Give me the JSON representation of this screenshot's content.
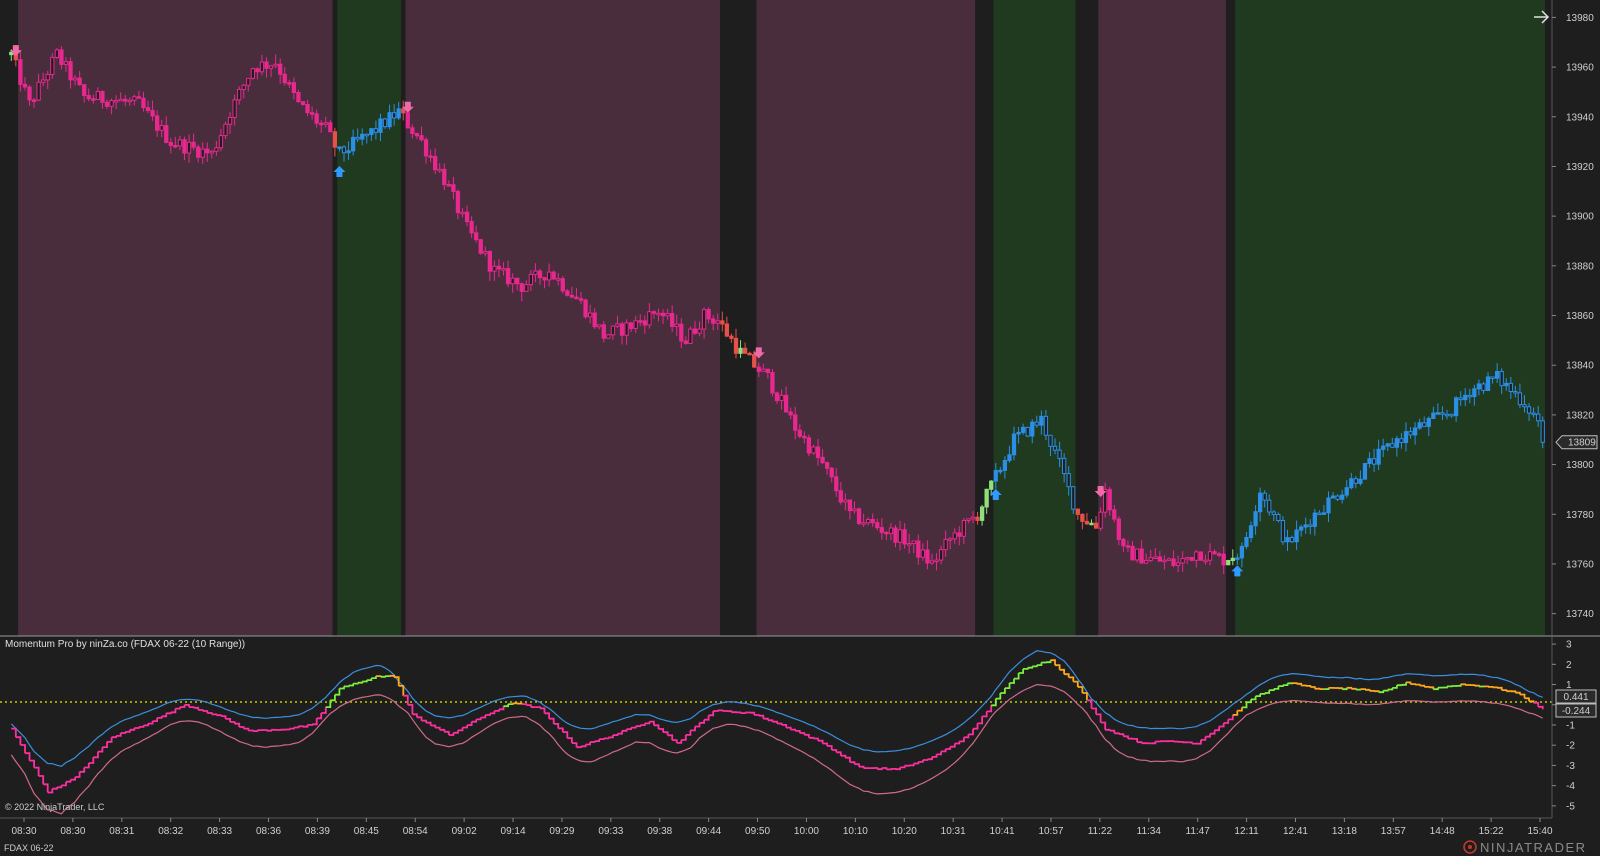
{
  "colors": {
    "background": "#1e1e1e",
    "bear_zone": "#4a2d3c",
    "bull_zone": "#1f3a1f",
    "bear_candle": "#e8288f",
    "bull_candle": "#2b8fe6",
    "transition_candle": "#8fe07a",
    "transition_alt": "#e8504a",
    "arrow_down": "#f06aa9",
    "arrow_up": "#2f9bff",
    "osc_fast_pink": "#ff2fa0",
    "osc_fast_green": "#7cf03c",
    "osc_fast_orange": "#ffa81a",
    "osc_upper_band": "#3a8fe0",
    "osc_lower_band": "#d06a8c",
    "zero_line": "#c8c800"
  },
  "header_icon": "arrow-right-icon",
  "price_panel": {
    "current_price_label": "13809"
  },
  "indicator_panel": {
    "title": "Momentum Pro by ninZa.co (FDAX 06-22 (10 Range))",
    "copyright": "© 2022 NinjaTrader, LLC",
    "badge_upper": "0.441",
    "badge_lower": "-0.244"
  },
  "footer": {
    "instrument": "FDAX 06-22",
    "brand": "NINJATRADER"
  },
  "chart_data": [
    {
      "type": "candlestick",
      "title": "",
      "x_tick_labels": [
        "08:30",
        "08:30",
        "08:31",
        "08:32",
        "08:33",
        "08:36",
        "08:39",
        "08:45",
        "08:54",
        "09:02",
        "09:14",
        "09:29",
        "09:33",
        "09:38",
        "09:44",
        "09:50",
        "10:00",
        "10:10",
        "10:20",
        "10:31",
        "10:41",
        "10:57",
        "11:22",
        "11:34",
        "11:47",
        "12:11",
        "12:41",
        "13:18",
        "13:57",
        "14:48",
        "15:22",
        "15:40"
      ],
      "y_tick_labels": [
        "13980",
        "13960",
        "13940",
        "13920",
        "13900",
        "13880",
        "13860",
        "13840",
        "13820",
        "13800",
        "13780",
        "13760",
        "13740"
      ],
      "ylim": [
        13731,
        13987
      ],
      "last_price": 13809,
      "price_path_keypoints": [
        [
          0,
          13965
        ],
        [
          4,
          13945
        ],
        [
          10,
          13965
        ],
        [
          16,
          13948
        ],
        [
          22,
          13947
        ],
        [
          28,
          13945
        ],
        [
          35,
          13930
        ],
        [
          44,
          13925
        ],
        [
          48,
          13942
        ],
        [
          53,
          13960
        ],
        [
          58,
          13962
        ],
        [
          63,
          13945
        ],
        [
          69,
          13935
        ],
        [
          72,
          13925
        ],
        [
          76,
          13930
        ],
        [
          80,
          13935
        ],
        [
          85,
          13942
        ],
        [
          90,
          13930
        ],
        [
          95,
          13915
        ],
        [
          100,
          13895
        ],
        [
          106,
          13878
        ],
        [
          112,
          13872
        ],
        [
          118,
          13878
        ],
        [
          125,
          13865
        ],
        [
          130,
          13852
        ],
        [
          136,
          13856
        ],
        [
          142,
          13862
        ],
        [
          148,
          13850
        ],
        [
          152,
          13860
        ],
        [
          155,
          13858
        ],
        [
          160,
          13845
        ],
        [
          166,
          13835
        ],
        [
          172,
          13815
        ],
        [
          178,
          13800
        ],
        [
          184,
          13780
        ],
        [
          190,
          13775
        ],
        [
          196,
          13770
        ],
        [
          202,
          13760
        ],
        [
          206,
          13770
        ],
        [
          212,
          13780
        ],
        [
          216,
          13795
        ],
        [
          220,
          13810
        ],
        [
          226,
          13818
        ],
        [
          230,
          13800
        ],
        [
          234,
          13780
        ],
        [
          238,
          13775
        ],
        [
          240,
          13790
        ],
        [
          244,
          13765
        ],
        [
          250,
          13762
        ],
        [
          256,
          13760
        ],
        [
          260,
          13765
        ],
        [
          266,
          13762
        ],
        [
          270,
          13765
        ],
        [
          274,
          13790
        ],
        [
          280,
          13768
        ],
        [
          286,
          13780
        ],
        [
          292,
          13790
        ],
        [
          298,
          13800
        ],
        [
          304,
          13810
        ],
        [
          310,
          13816
        ],
        [
          316,
          13822
        ],
        [
          320,
          13830
        ],
        [
          326,
          13835
        ],
        [
          332,
          13825
        ],
        [
          336,
          13815
        ]
      ],
      "zones": [
        {
          "regime": "neutral",
          "from": 0,
          "to": 2
        },
        {
          "regime": "bear",
          "from": 2,
          "to": 71
        },
        {
          "regime": "neutral",
          "from": 71,
          "to": 72
        },
        {
          "regime": "bull",
          "from": 72,
          "to": 86
        },
        {
          "regime": "neutral",
          "from": 86,
          "to": 87
        },
        {
          "regime": "bear",
          "from": 87,
          "to": 156
        },
        {
          "regime": "neutral",
          "from": 156,
          "to": 164
        },
        {
          "regime": "bear",
          "from": 164,
          "to": 212
        },
        {
          "regime": "neutral",
          "from": 212,
          "to": 216
        },
        {
          "regime": "bull",
          "from": 216,
          "to": 234
        },
        {
          "regime": "neutral",
          "from": 234,
          "to": 239
        },
        {
          "regime": "bear",
          "from": 239,
          "to": 267
        },
        {
          "regime": "neutral",
          "from": 267,
          "to": 269
        },
        {
          "regime": "bull",
          "from": 269,
          "to": 337
        }
      ],
      "signals": [
        {
          "dir": "down",
          "bar": 1
        },
        {
          "dir": "up",
          "bar": 72
        },
        {
          "dir": "down",
          "bar": 87
        },
        {
          "dir": "down",
          "bar": 164
        },
        {
          "dir": "up",
          "bar": 216
        },
        {
          "dir": "down",
          "bar": 239
        },
        {
          "dir": "up",
          "bar": 269
        }
      ]
    },
    {
      "type": "line",
      "title": "Momentum Pro by ninZa.co (FDAX 06-22 (10 Range))",
      "y_tick_labels": [
        "3",
        "2",
        "1",
        "0",
        "-1",
        "-2",
        "-3",
        "-4",
        "-5"
      ],
      "ylim": [
        -5.6,
        3.4
      ],
      "zero_line": 0,
      "last_values": {
        "upper": 0.441,
        "lower": -0.244
      },
      "series_keypoints": [
        [
          0,
          -1.2
        ],
        [
          8,
          -4.3
        ],
        [
          14,
          -3.6
        ],
        [
          22,
          -1.6
        ],
        [
          30,
          -0.9
        ],
        [
          38,
          0.0
        ],
        [
          46,
          -0.6
        ],
        [
          52,
          -1.3
        ],
        [
          60,
          -1.2
        ],
        [
          66,
          -1.0
        ],
        [
          72,
          0.8
        ],
        [
          80,
          1.4
        ],
        [
          84,
          1.4
        ],
        [
          88,
          -0.5
        ],
        [
          96,
          -1.5
        ],
        [
          104,
          -0.5
        ],
        [
          110,
          0.1
        ],
        [
          116,
          -0.2
        ],
        [
          124,
          -2.1
        ],
        [
          132,
          -1.5
        ],
        [
          140,
          -0.8
        ],
        [
          146,
          -1.9
        ],
        [
          154,
          -0.3
        ],
        [
          162,
          -0.4
        ],
        [
          170,
          -1.1
        ],
        [
          178,
          -1.9
        ],
        [
          186,
          -3.1
        ],
        [
          194,
          -3.2
        ],
        [
          202,
          -2.6
        ],
        [
          210,
          -1.5
        ],
        [
          216,
          0.3
        ],
        [
          222,
          1.8
        ],
        [
          228,
          2.2
        ],
        [
          234,
          0.9
        ],
        [
          240,
          -1.2
        ],
        [
          248,
          -1.9
        ],
        [
          254,
          -1.8
        ],
        [
          260,
          -1.9
        ],
        [
          266,
          -0.9
        ],
        [
          272,
          0.3
        ],
        [
          280,
          1.1
        ],
        [
          286,
          0.8
        ],
        [
          294,
          0.8
        ],
        [
          300,
          0.6
        ],
        [
          306,
          1.1
        ],
        [
          312,
          0.8
        ],
        [
          318,
          1.0
        ],
        [
          324,
          0.9
        ],
        [
          330,
          0.6
        ],
        [
          336,
          -0.2
        ]
      ]
    }
  ]
}
